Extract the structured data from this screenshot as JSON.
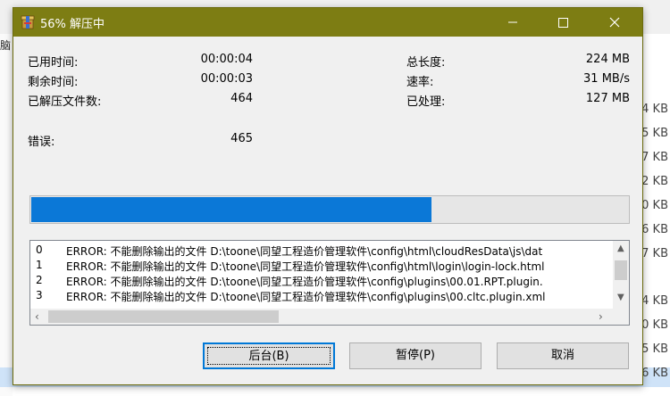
{
  "window": {
    "title": "56% 解压中",
    "accent": "#7d7d13"
  },
  "stats": {
    "elapsed_label": "已用时间:",
    "elapsed_value": "00:00:04",
    "remaining_label": "剩余时间:",
    "remaining_value": "00:00:03",
    "files_label": "已解压文件数:",
    "files_value": "464",
    "errors_label": "错误:",
    "errors_value": "465",
    "total_label": "总长度:",
    "total_value": "224 MB",
    "speed_label": "速率:",
    "speed_value": "31 MB/s",
    "processed_label": "已处理:",
    "processed_value": "127 MB"
  },
  "progress": {
    "percent": 67,
    "color": "#0b78d7"
  },
  "log": [
    {
      "num": "0",
      "msg": "ERROR: 不能删除输出的文件 D:\\toone\\同望工程造价管理软件\\config\\html\\cloudResData\\js\\dat"
    },
    {
      "num": "1",
      "msg": "ERROR: 不能删除输出的文件 D:\\toone\\同望工程造价管理软件\\config\\html\\login\\login-lock.html"
    },
    {
      "num": "2",
      "msg": "ERROR: 不能删除输出的文件 D:\\toone\\同望工程造价管理软件\\config\\plugins\\00.01.RPT.plugin."
    },
    {
      "num": "3",
      "msg": "ERROR: 不能删除输出的文件 D:\\toone\\同望工程造价管理软件\\config\\plugins\\00.cltc.plugin.xml"
    }
  ],
  "buttons": {
    "background": "后台(B)",
    "pause": "暂停(P)",
    "cancel": "取消"
  },
  "background_window": {
    "left_char": "脑",
    "sizes": [
      "4 KB",
      "5 KB",
      "7 KB",
      "2 KB",
      "0 KB",
      "6 KB",
      "7 KB",
      "4 KB",
      "0 KB",
      "5 KB",
      "6 KB"
    ]
  }
}
